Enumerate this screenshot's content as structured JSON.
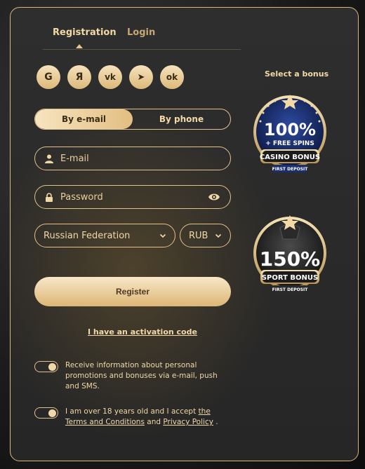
{
  "tabs": {
    "registration": "Registration",
    "login": "Login"
  },
  "socials": [
    {
      "name": "google",
      "glyph": "G"
    },
    {
      "name": "yandex",
      "glyph": "Я"
    },
    {
      "name": "vk",
      "glyph": "vk"
    },
    {
      "name": "telegram",
      "glyph": "➤"
    },
    {
      "name": "odnoklassniki",
      "glyph": "ok"
    }
  ],
  "mode": {
    "email": "By e-mail",
    "phone": "By phone"
  },
  "email": {
    "placeholder": "E-mail"
  },
  "password": {
    "placeholder": "Password"
  },
  "country": {
    "value": "Russian Federation"
  },
  "currency": {
    "value": "RUB"
  },
  "register_label": "Register",
  "activation_label": "I have an activation code",
  "promo_toggle": {
    "text": "Receive information about personal promotions and bonuses via e-mail, push and SMS."
  },
  "terms_toggle": {
    "prefix": "I am over 18 years old and I accept ",
    "terms_link": "the Terms and Conditions",
    "and": " and ",
    "privacy_link": "Privacy Policy",
    "suffix": " ."
  },
  "bonus": {
    "title": "Select a bonus",
    "casino": {
      "amount": "100%",
      "extra": "+ FREE SPINS",
      "label": "CASINO BONUS",
      "sub": "FIRST DEPOSIT"
    },
    "sport": {
      "amount": "150%",
      "label": "SPORT BONUS",
      "sub": "FIRST DEPOSIT"
    }
  },
  "colors": {
    "accent": "#e2c18a",
    "text": "#f0d8a8",
    "casino_blue": "#1b2f6e"
  }
}
